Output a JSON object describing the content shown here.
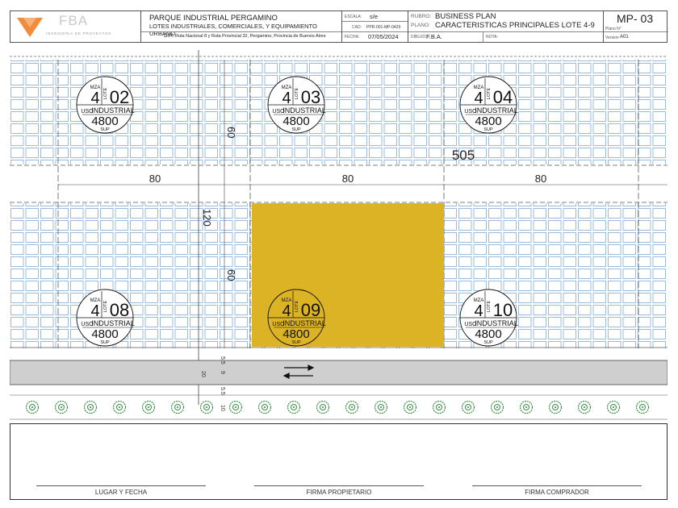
{
  "logo": {
    "brand": "FBA",
    "tagline": "INGENIERIA DE PROYECTOS"
  },
  "header": {
    "project_title": "PARQUE INDUSTRIAL PERGAMINO",
    "project_subtitle": "LOTES INDUSTRIALES, COMERCIALES, Y EQUIPAMIENTO URBANO",
    "dir_label": "DIR.",
    "dir_value": "Ruta Nacional 8 y Ruta Provincial 32, Pergamino, Provincia de Buenos Aires",
    "escala_label": "ESCALA:",
    "escala_value": "s/e",
    "cad_label": "CAD:",
    "cad_value": "PPR-001-MP-0429",
    "fecha_label": "FECHA:",
    "fecha_value": "07/05/2024",
    "rubro_label": "RUBRO:",
    "rubro_value": "BUSINESS PLAN",
    "plano_label": "PLANO:",
    "plano_value": "CARACTERISTICAS PRINCIPALES LOTE 4-9",
    "dibujo_label": "DIBUJO:",
    "dibujo_value": "F.B.A.",
    "nota_label": "NOTA:",
    "sheet_code": "MP- 03",
    "plano_n_label": "Plano N°",
    "version_label": "Version",
    "version_value": "A01"
  },
  "lots": [
    {
      "mza": "4",
      "lote": "02",
      "uso": "INDUSTRIAL",
      "sup": "4800",
      "highlighted": false
    },
    {
      "mza": "4",
      "lote": "03",
      "uso": "INDUSTRIAL",
      "sup": "4800",
      "highlighted": false
    },
    {
      "mza": "4",
      "lote": "04",
      "uso": "INDUSTRIAL",
      "sup": "4800",
      "highlighted": false
    },
    {
      "mza": "4",
      "lote": "08",
      "uso": "INDUSTRIAL",
      "sup": "4800",
      "highlighted": false
    },
    {
      "mza": "4",
      "lote": "09",
      "uso": "INDUSTRIAL",
      "sup": "4800",
      "highlighted": true
    },
    {
      "mza": "4",
      "lote": "10",
      "uso": "INDUSTRIAL",
      "sup": "4800",
      "highlighted": false
    }
  ],
  "lot_labels": {
    "mza": "MZA",
    "lote": "LOTE",
    "uso": "USO",
    "sup": "SUP"
  },
  "dimensions": {
    "width_a": "80",
    "width_b": "80",
    "width_c": "80",
    "depth_top": "60",
    "depth_bottom": "60",
    "depth_total": "120",
    "total_length": "505",
    "road_sidewalk_top": "5.5",
    "road_width": "9",
    "road_sidewalk_bottom": "5.5",
    "road_total": "20",
    "strip": "10"
  },
  "colors": {
    "highlight": "#dcb324",
    "grid": "#8fb4d9",
    "tree": "#3a8a45",
    "road": "#cfcfcf"
  },
  "signatures": {
    "place_date": "LUGAR Y FECHA",
    "owner": "FIRMA PROPIETARIO",
    "buyer": "FIRMA COMPRADOR"
  }
}
